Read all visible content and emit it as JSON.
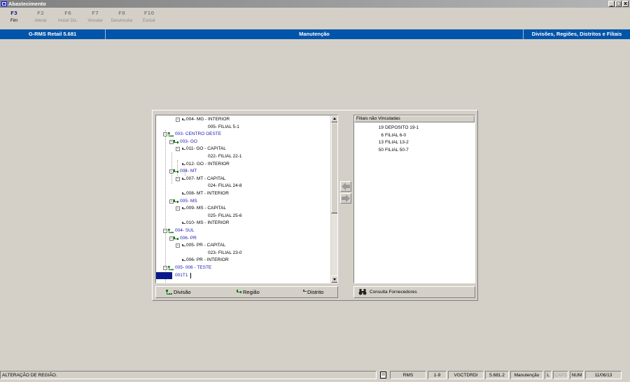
{
  "window": {
    "title": "Abastecimento",
    "buttons": {
      "minimize": "_",
      "maximize": "□",
      "close": "x"
    }
  },
  "toolbar": {
    "fkeys": [
      {
        "key": "F3",
        "label": "Fim",
        "enabled": true
      },
      {
        "key": "F2",
        "label": "Alterar",
        "enabled": false
      },
      {
        "key": "F6",
        "label": "Incluir Dis.",
        "enabled": false
      },
      {
        "key": "F7",
        "label": "Vincular",
        "enabled": false
      },
      {
        "key": "F8",
        "label": "Desvincular",
        "enabled": false
      },
      {
        "key": "F10",
        "label": "Excluir",
        "enabled": false
      }
    ]
  },
  "header": {
    "left": "G-RMS Retail 5.681",
    "center": "Manutenção",
    "right": "Divisões, Regiões, Distritos e Filiais",
    "color": "#0055aa"
  },
  "tree": {
    "nodes": [
      {
        "text": "004- MG - INTERIOR",
        "kind": "district",
        "expander": "-"
      },
      {
        "text": "005- FILIAL 5-1",
        "kind": "branch"
      },
      {
        "text": "003- CENTRO OESTE",
        "kind": "division",
        "expander": "-"
      },
      {
        "text": "003- GO",
        "kind": "region",
        "expander": "-"
      },
      {
        "text": "011- GO - CAPITAL",
        "kind": "district",
        "expander": "-"
      },
      {
        "text": "022- FILIAL 22-1",
        "kind": "branch"
      },
      {
        "text": "012- GO - INTERIOR",
        "kind": "district"
      },
      {
        "text": "004- MT",
        "kind": "region",
        "expander": "-"
      },
      {
        "text": "007- MT - CAPITAL",
        "kind": "district",
        "expander": "-"
      },
      {
        "text": "024- FILIAL 24-8",
        "kind": "branch"
      },
      {
        "text": "008- MT - INTERIOR",
        "kind": "district"
      },
      {
        "text": "005- MS",
        "kind": "region",
        "expander": "-"
      },
      {
        "text": "009- MS - CAPITAL",
        "kind": "district",
        "expander": "-"
      },
      {
        "text": "025- FILIAL 25-6",
        "kind": "branch"
      },
      {
        "text": "010- MS - INTERIOR",
        "kind": "district"
      },
      {
        "text": "004- SUL",
        "kind": "division",
        "expander": "-"
      },
      {
        "text": "006- PR",
        "kind": "region",
        "expander": "-"
      },
      {
        "text": "005- PR - CAPITAL",
        "kind": "district",
        "expander": "-"
      },
      {
        "text": "023- FILIAL 23-0",
        "kind": "branch"
      },
      {
        "text": "006- PR - INTERIOR",
        "kind": "district"
      },
      {
        "text": "005- 006 - TESTE",
        "kind": "division",
        "expander": "-"
      },
      {
        "text": "001T1",
        "kind": "editing"
      }
    ]
  },
  "list": {
    "header": "Filiais não Vinculadas",
    "rows": [
      {
        "code": "19",
        "name": "DEPOSITO 19-1"
      },
      {
        "code": "6",
        "name": "FILIAL 6-0"
      },
      {
        "code": "13",
        "name": "FILIAL 13-2"
      },
      {
        "code": "50",
        "name": "FILIAL 50-7"
      }
    ]
  },
  "buttons": {
    "divisao": "Divisão",
    "regiao": "Região",
    "distrito": "Distrito",
    "consulta": "Consulta Fornecedores"
  },
  "status": {
    "message": "ALTERAÇÃO DE REGIÃO.",
    "cells": [
      "RMS",
      "1-9",
      "VGCTDRDI",
      "5.681.2",
      "Manutenção",
      "L",
      "CAPS",
      "NUM",
      "11/06/13"
    ]
  }
}
